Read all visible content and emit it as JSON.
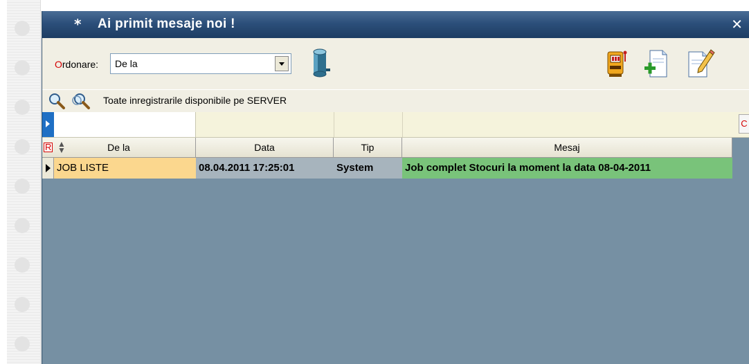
{
  "window": {
    "title_star": "*",
    "title": "Ai primit mesaje noi !",
    "close_glyph": "✕"
  },
  "toolbar": {
    "order_label_first": "O",
    "order_label_rest": "rdonare:",
    "order_value": "De la",
    "icons": [
      "database-icon",
      "slot-machine-icon",
      "new-document-icon",
      "edit-document-icon"
    ]
  },
  "filter": {
    "text": "Toate inregistrarile disponibile pe SERVER",
    "icons": [
      "search-icon",
      "search-all-icon"
    ]
  },
  "edit_row": {
    "clear_button": "C"
  },
  "grid": {
    "row_marker": "R",
    "columns": [
      "De la",
      "Data",
      "Tip",
      "Mesaj"
    ],
    "rows": [
      [
        "JOB LISTE",
        "08.04.2011 17:25:01",
        "System",
        "Job complet Stocuri  la moment la data 08-04-2011"
      ]
    ]
  },
  "colors": {
    "title_bar": "#1d3d63",
    "background": "#7690a3",
    "from_cell": "#fbd78e",
    "message_cell": "#79c37a",
    "accent_red": "#d40000"
  }
}
